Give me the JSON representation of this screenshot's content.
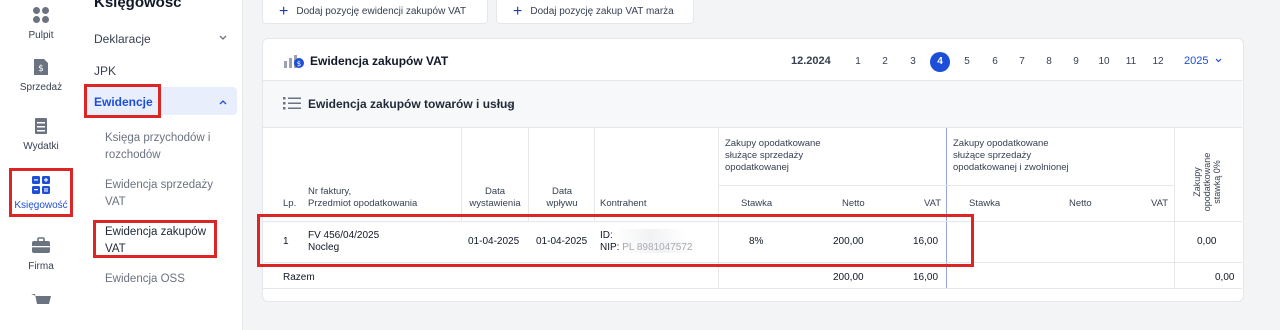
{
  "rail": {
    "items": [
      {
        "label": "Pulpit"
      },
      {
        "label": "Sprzedaż"
      },
      {
        "label": "Wydatki"
      },
      {
        "label": "Księgowość"
      },
      {
        "label": "Firma"
      }
    ]
  },
  "sidebar": {
    "title": "Księgowośc",
    "deklaracje": "Deklaracje",
    "jpk": "JPK",
    "ewidencje": "Ewidencje",
    "sub": {
      "ksiega_1": "Księga przychodów i",
      "ksiega_2": "rozchodów",
      "sprzedazy_1": "Ewidencja sprzedaży",
      "sprzedazy_2": "VAT",
      "zakupow_1": "Ewidencja zakupów",
      "zakupow_2": "VAT",
      "oss": "Ewidencja OSS"
    }
  },
  "toolbar": {
    "add_vat": "Dodaj pozycję ewidencji zakupów VAT",
    "add_marza": "Dodaj pozycję zakup VAT marża"
  },
  "card": {
    "title": "Ewidencja zakupów VAT",
    "period": "12.2024",
    "months": [
      "1",
      "2",
      "3",
      "4",
      "5",
      "6",
      "7",
      "8",
      "9",
      "10",
      "11",
      "12"
    ],
    "active_month": "4",
    "year": "2025",
    "section_title": "Ewidencja zakupów towarów i usług"
  },
  "table": {
    "headers": {
      "lp": "Lp.",
      "nr_1": "Nr faktury,",
      "nr_2": "Przedmiot opodatkowania",
      "data_wyst_1": "Data",
      "data_wyst_2": "wystawienia",
      "data_wpl_1": "Data",
      "data_wpl_2": "wpływu",
      "kontrahent": "Kontrahent",
      "group1_1": "Zakupy opodatkowane",
      "group1_2": "służące sprzedaży",
      "group1_3": "opodatkowanej",
      "group2_1": "Zakupy opodatkowane",
      "group2_2": "służące sprzedaży",
      "group2_3": "opodatkowanej i zwolnionej",
      "stawka": "Stawka",
      "netto": "Netto",
      "vat": "VAT",
      "stawka2": "Stawka",
      "netto2": "Netto",
      "vat2": "VAT",
      "zero_1": "Zakupy",
      "zero_2": "opodatkowane",
      "zero_3": "stawką 0%"
    },
    "row": {
      "lp": "1",
      "nr": "FV 456/04/2025",
      "przedmiot": "Nocleg",
      "data_wyst": "01-04-2025",
      "data_wpl": "01-04-2025",
      "id_label": "ID:",
      "nip_label": "NIP: PL 8981047572",
      "stawka": "8%",
      "netto": "200,00",
      "vat": "16,00",
      "zero": "0,00"
    },
    "footer": {
      "label": "Razem",
      "netto": "200,00",
      "vat": "16,00",
      "zero": "0,00"
    }
  },
  "colors": {
    "accent": "#1d4ed8",
    "highlight": "#dc2626"
  }
}
